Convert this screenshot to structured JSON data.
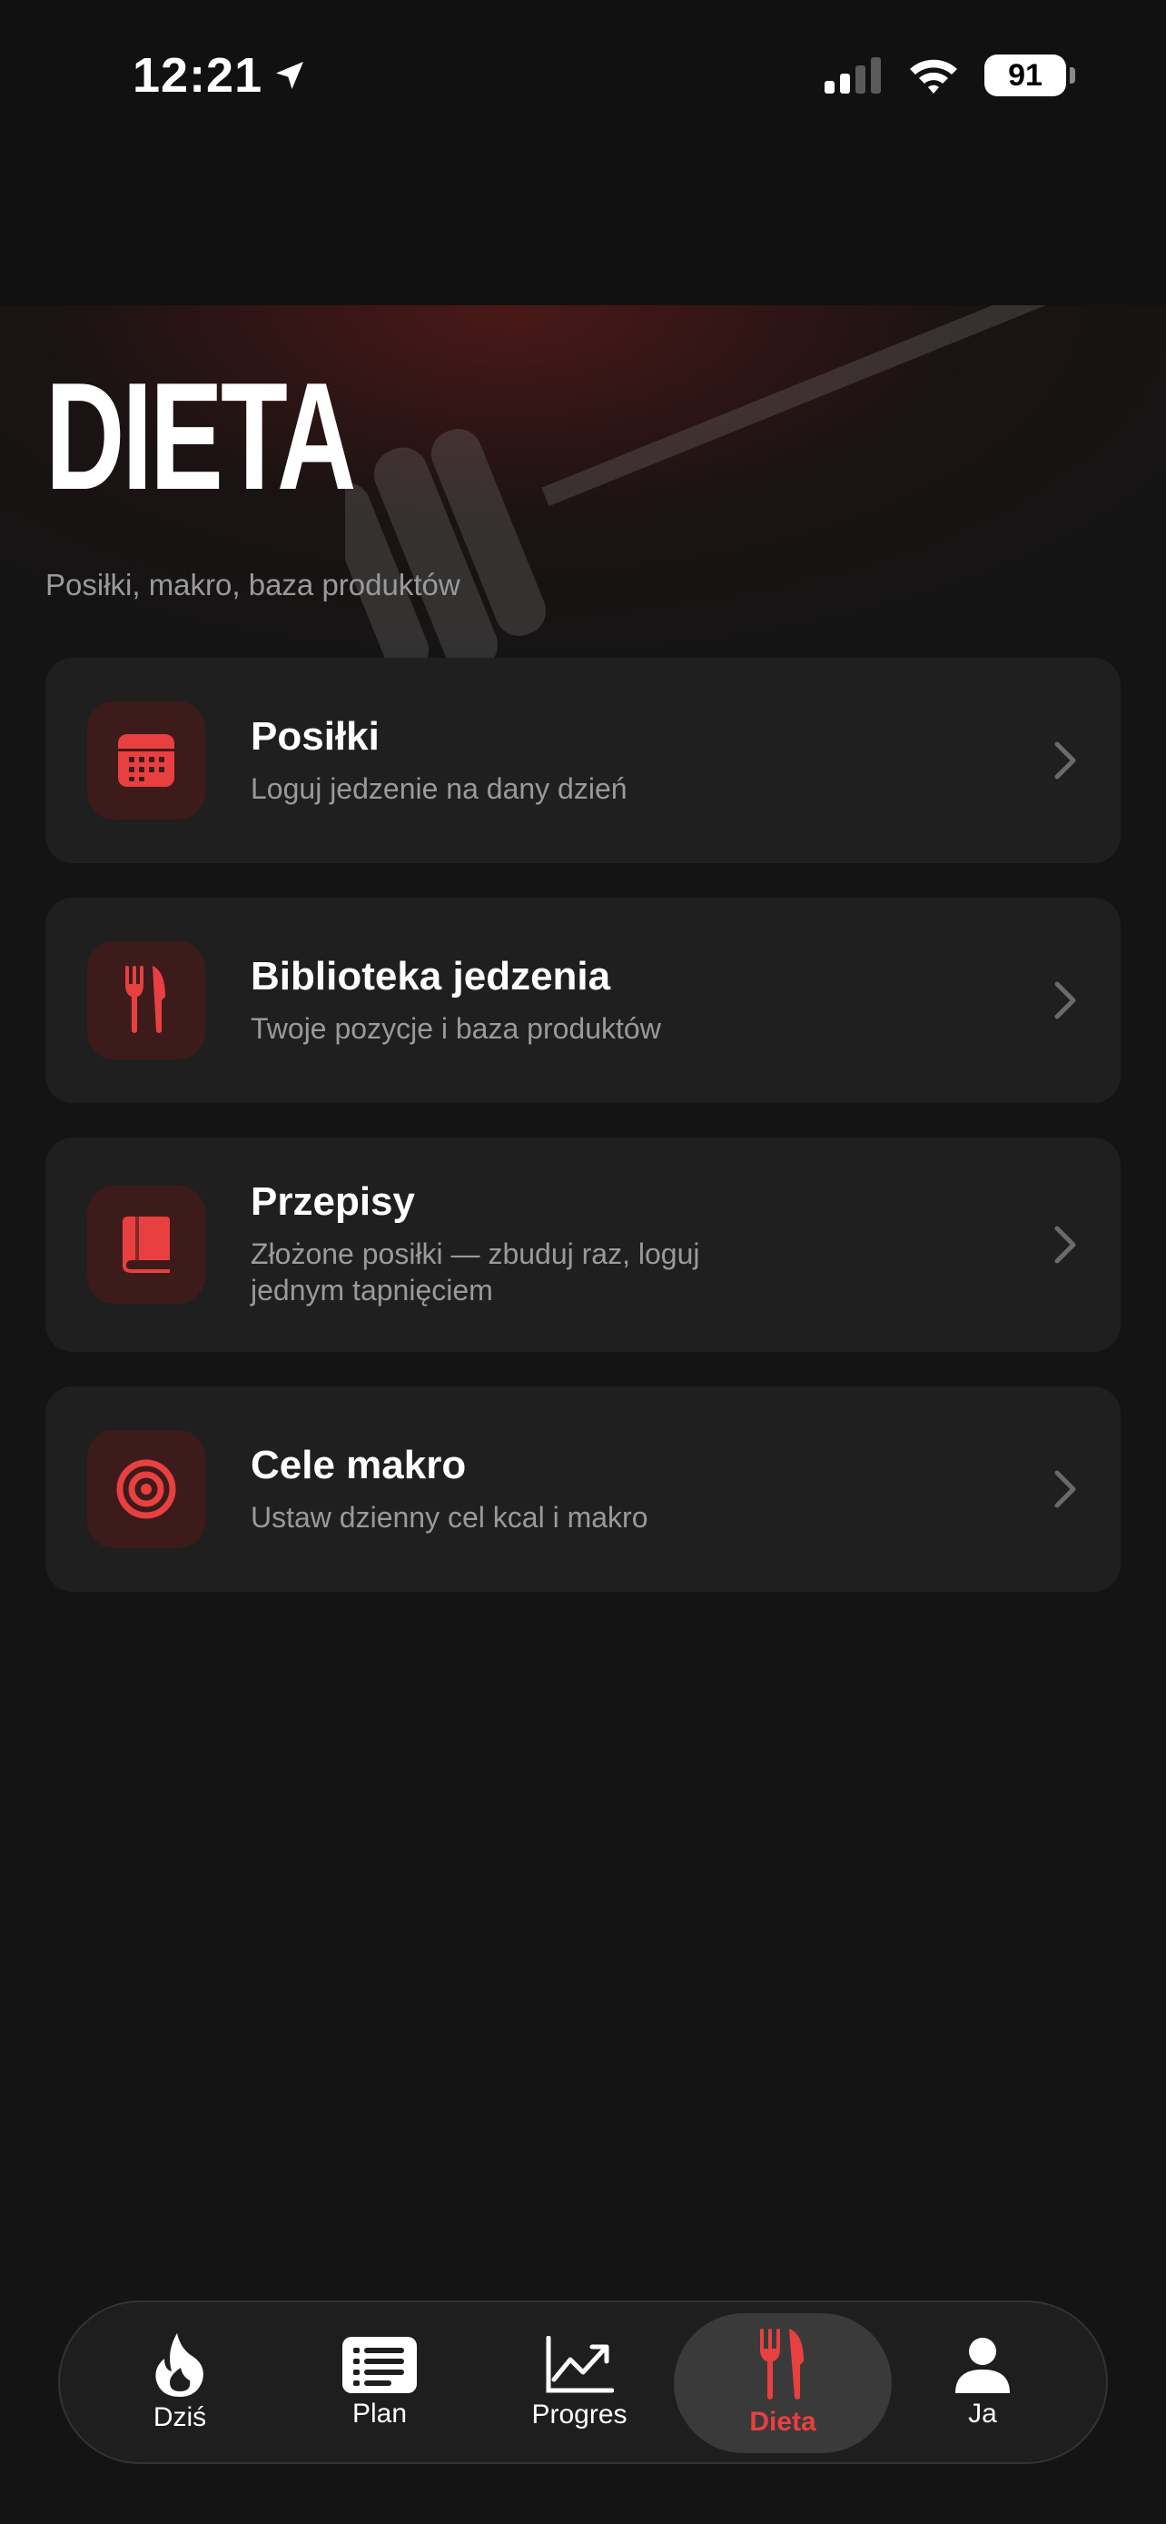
{
  "status": {
    "time": "12:21",
    "battery": "91"
  },
  "header": {
    "title": "DIETA",
    "subtitle": "Posiłki, makro, baza produktów"
  },
  "menu": [
    {
      "title": "Posiłki",
      "desc": "Loguj jedzenie na dany dzień",
      "icon": "calendar-icon"
    },
    {
      "title": "Biblioteka jedzenia",
      "desc": "Twoje pozycje i baza produktów",
      "icon": "fork-knife-icon"
    },
    {
      "title": "Przepisy",
      "desc": "Złożone posiłki — zbuduj raz, loguj jednym tapnięciem",
      "icon": "book-icon"
    },
    {
      "title": "Cele makro",
      "desc": "Ustaw dzienny cel kcal i makro",
      "icon": "target-icon"
    }
  ],
  "tabs": [
    {
      "label": "Dziś",
      "icon": "flame-icon"
    },
    {
      "label": "Plan",
      "icon": "list-icon"
    },
    {
      "label": "Progres",
      "icon": "chart-icon"
    },
    {
      "label": "Dieta",
      "icon": "fork-knife-icon",
      "active": true
    },
    {
      "label": "Ja",
      "icon": "person-icon"
    }
  ],
  "colors": {
    "accent": "#e84040",
    "icon_bg": "#3d1b1b",
    "card_bg": "#1f1f1f",
    "background": "#141414"
  }
}
